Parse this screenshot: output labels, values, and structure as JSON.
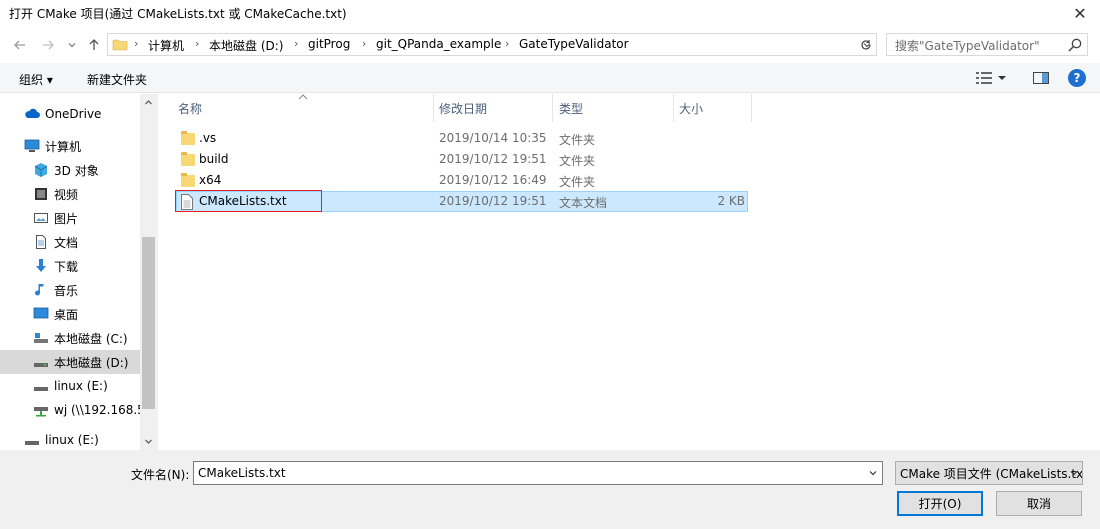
{
  "window": {
    "title": "打开 CMake 项目(通过 CMakeLists.txt 或 CMakeCache.txt)",
    "close_glyph": "✕"
  },
  "address": {
    "breadcrumbs": [
      "计算机",
      "本地磁盘 (D:)",
      "gitProg",
      "git_QPanda_example",
      "GateTypeValidator"
    ],
    "search_placeholder": "搜索\"GateTypeValidator\""
  },
  "toolbar": {
    "organize_label": "组织 ▾",
    "new_folder_label": "新建文件夹"
  },
  "nav": {
    "items": [
      {
        "label": "OneDrive",
        "icon": "cloud-icon"
      },
      {
        "label": "计算机",
        "icon": "computer-icon"
      },
      {
        "label": "3D 对象",
        "icon": "cube-icon"
      },
      {
        "label": "视频",
        "icon": "video-icon"
      },
      {
        "label": "图片",
        "icon": "picture-icon"
      },
      {
        "label": "文档",
        "icon": "document-icon"
      },
      {
        "label": "下载",
        "icon": "download-icon"
      },
      {
        "label": "音乐",
        "icon": "music-icon"
      },
      {
        "label": "桌面",
        "icon": "desktop-icon"
      },
      {
        "label": "本地磁盘 (C:)",
        "icon": "drive-icon"
      },
      {
        "label": "本地磁盘 (D:)",
        "icon": "drive-icon",
        "selected": true
      },
      {
        "label": "linux (E:)",
        "icon": "drive-icon"
      },
      {
        "label": "wj (\\\\192.168.5",
        "icon": "network-drive-icon"
      },
      {
        "label": "linux (E:)",
        "icon": "drive-icon"
      }
    ]
  },
  "filelist": {
    "columns": [
      "名称",
      "修改日期",
      "类型",
      "大小"
    ],
    "rows": [
      {
        "name": ".vs",
        "date": "2019/10/14 10:35",
        "type": "文件夹",
        "size": "",
        "icon": "folder-icon"
      },
      {
        "name": "build",
        "date": "2019/10/12 19:51",
        "type": "文件夹",
        "size": "",
        "icon": "folder-icon"
      },
      {
        "name": "x64",
        "date": "2019/10/12 16:49",
        "type": "文件夹",
        "size": "",
        "icon": "folder-icon"
      },
      {
        "name": "CMakeLists.txt",
        "date": "2019/10/12 19:51",
        "type": "文本文档",
        "size": "2 KB",
        "icon": "text-file-icon",
        "selected": true
      }
    ]
  },
  "bottom": {
    "filename_label": "文件名(N):",
    "filename_value": "CMakeLists.txt",
    "filetype_value": "CMake 项目文件 (CMakeLists.txt)",
    "open_label": "打开(O)",
    "cancel_label": "取消"
  },
  "colors": {
    "selection_bg": "#cce8ff",
    "selection_border": "#99d1ff",
    "annotation_red": "#e02020",
    "accent": "#0078d7"
  }
}
